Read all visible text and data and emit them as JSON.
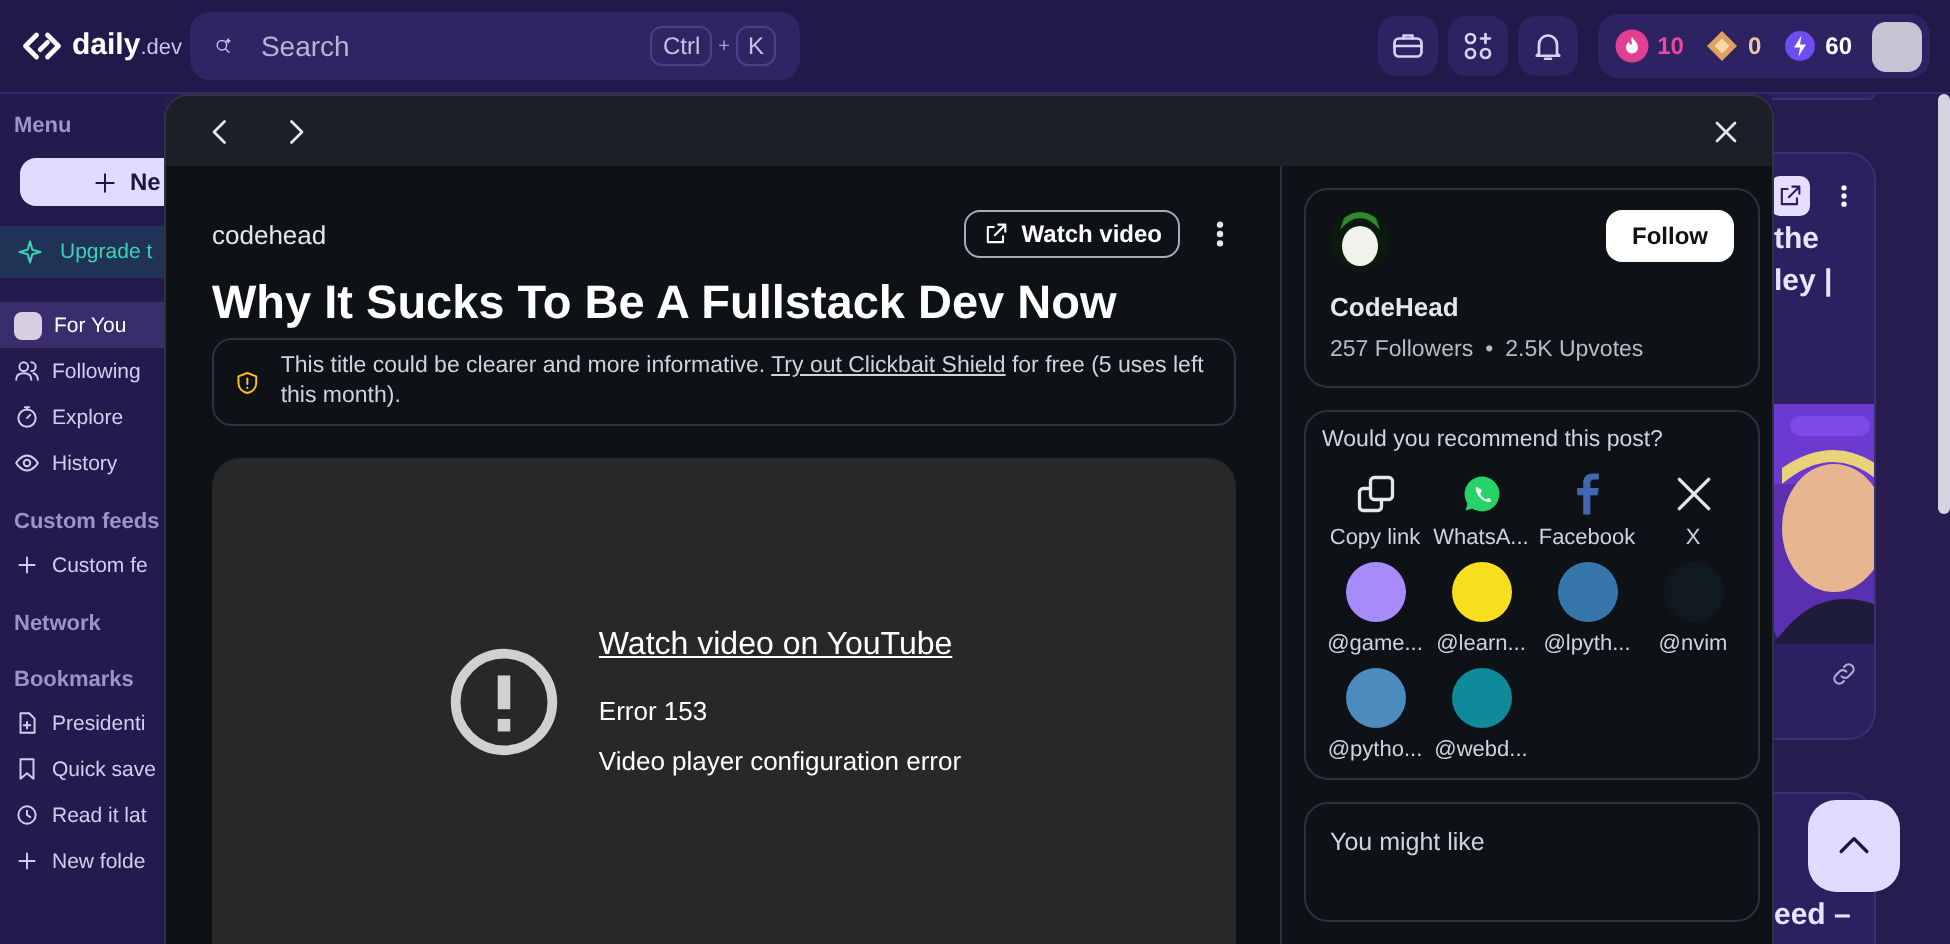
{
  "header": {
    "logo": {
      "name": "daily",
      "suffix": ".dev"
    },
    "search": {
      "placeholder": "Search",
      "shortcut": [
        "Ctrl",
        "+",
        "K"
      ]
    },
    "counters": [
      {
        "kind": "reputation",
        "value": "10"
      },
      {
        "kind": "cores",
        "value": "0"
      },
      {
        "kind": "streak",
        "value": "60"
      }
    ]
  },
  "sidebar": {
    "new_button": "Ne",
    "upgrade": "Upgrade t",
    "sections": [
      {
        "heading": "Menu",
        "items": [
          {
            "kind": "profile",
            "label": "For You",
            "selected": true
          },
          {
            "kind": "following",
            "label": "Following",
            "selected": false
          },
          {
            "kind": "explore",
            "label": "Explore",
            "selected": false
          },
          {
            "kind": "history",
            "label": "History",
            "selected": false
          }
        ]
      },
      {
        "heading": "Custom feeds",
        "items": [
          {
            "kind": "add",
            "label": "Custom fe",
            "selected": false
          }
        ]
      },
      {
        "heading": "Network"
      },
      {
        "heading": "Bookmarks",
        "items": [
          {
            "kind": "document",
            "label": "Presidenti",
            "selected": false
          },
          {
            "kind": "bookmark",
            "label": "Quick save",
            "selected": false
          },
          {
            "kind": "clock",
            "label": "Read it lat",
            "selected": false
          },
          {
            "kind": "add",
            "label": "New folde",
            "selected": false
          }
        ]
      }
    ]
  },
  "modal": {
    "source": "codehead",
    "watch_button": "Watch video",
    "title": "Why It Sucks To Be A Fullstack Dev Now",
    "notice": {
      "before": "This title could be clearer and more informative. ",
      "link": "Try out Clickbait Shield",
      "after": " for free (5 uses left this month)."
    },
    "video": {
      "link": "Watch video on YouTube",
      "error_code": "Error 153",
      "error_message": "Video player configuration error"
    },
    "author": {
      "name": "CodeHead",
      "followers": "257 Followers",
      "separator": "•",
      "upvotes": "2.5K Upvotes",
      "follow_button": "Follow"
    },
    "share": {
      "prompt": "Would you recommend this post?",
      "targets": [
        {
          "kind": "copy",
          "label": "Copy link"
        },
        {
          "kind": "whatsapp",
          "label": "WhatsA..."
        },
        {
          "kind": "facebook",
          "label": "Facebook"
        },
        {
          "kind": "x",
          "label": "X"
        }
      ],
      "squads": [
        {
          "label": "@game...",
          "color": "#a78bfa"
        },
        {
          "label": "@learn...",
          "color": "#f7df1e"
        },
        {
          "label": "@lpyth...",
          "color": "#3776ab"
        },
        {
          "label": "@nvim",
          "color": "#0f1a1f"
        },
        {
          "label": "@pytho...",
          "color": "#4b8bbe"
        },
        {
          "label": "@webd...",
          "color": "#0e8a9a"
        }
      ]
    },
    "related": {
      "heading": "You might like"
    }
  },
  "feed": {
    "cards": [
      {
        "kind": "tail"
      },
      {
        "kind": "post",
        "title_lines": [
          "the",
          "ley |"
        ]
      },
      {
        "kind": "head",
        "title_lines": [
          "eed –"
        ]
      }
    ]
  }
}
